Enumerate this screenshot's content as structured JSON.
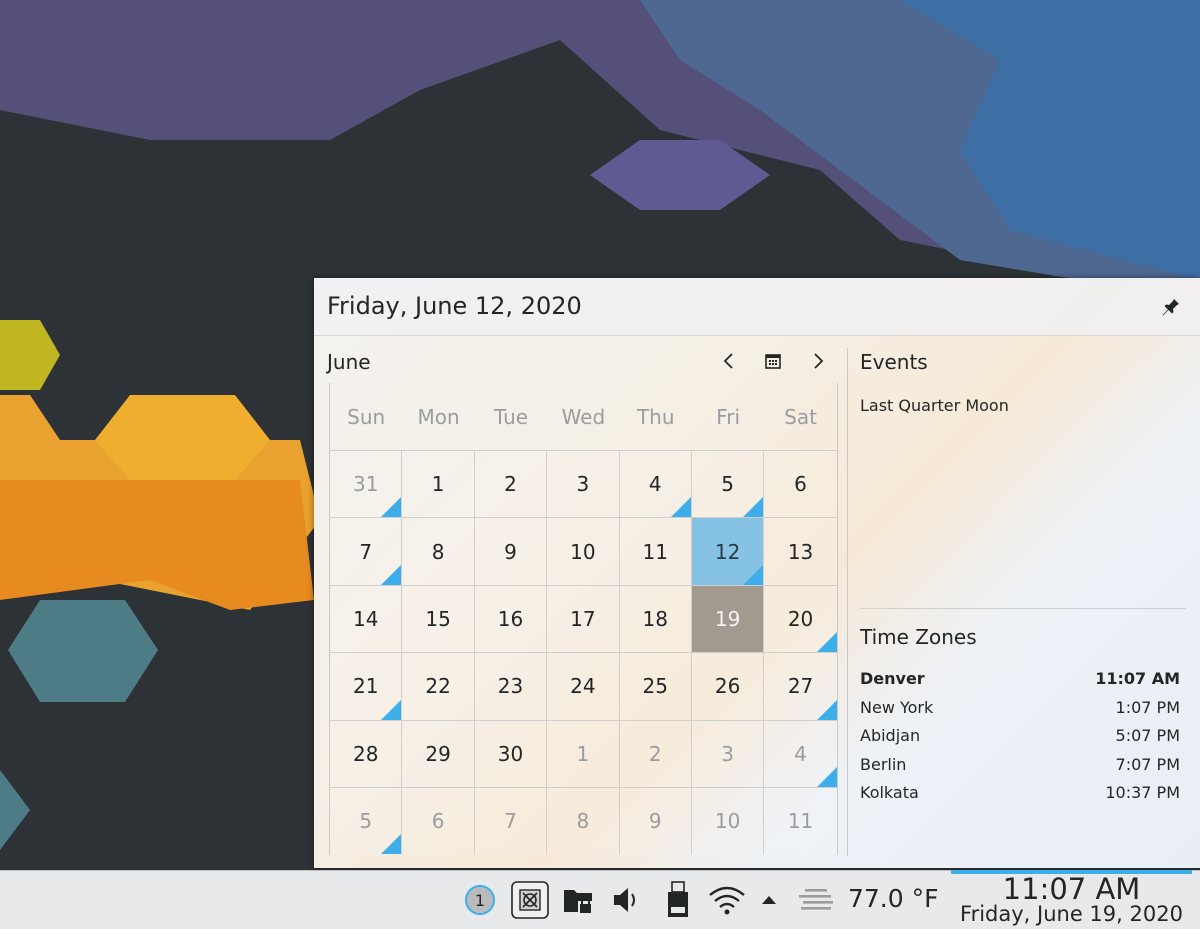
{
  "popup": {
    "title": "Friday, June 12, 2020",
    "pin_icon": "pin-icon"
  },
  "calendar": {
    "month_label": "June",
    "prev_icon": "chevron-left-icon",
    "today_icon": "calendar-icon",
    "next_icon": "chevron-right-icon",
    "weekdays": [
      "Sun",
      "Mon",
      "Tue",
      "Wed",
      "Thu",
      "Fri",
      "Sat"
    ],
    "weeks": [
      [
        {
          "d": "31",
          "o": true,
          "e": true
        },
        {
          "d": "1"
        },
        {
          "d": "2"
        },
        {
          "d": "3"
        },
        {
          "d": "4",
          "e": true
        },
        {
          "d": "5",
          "e": true
        },
        {
          "d": "6"
        }
      ],
      [
        {
          "d": "7",
          "e": true
        },
        {
          "d": "8"
        },
        {
          "d": "9"
        },
        {
          "d": "10"
        },
        {
          "d": "11"
        },
        {
          "d": "12",
          "sel": true,
          "e": true
        },
        {
          "d": "13"
        }
      ],
      [
        {
          "d": "14"
        },
        {
          "d": "15"
        },
        {
          "d": "16"
        },
        {
          "d": "17"
        },
        {
          "d": "18"
        },
        {
          "d": "19",
          "today": true
        },
        {
          "d": "20",
          "e": true
        }
      ],
      [
        {
          "d": "21",
          "e": true
        },
        {
          "d": "22"
        },
        {
          "d": "23"
        },
        {
          "d": "24"
        },
        {
          "d": "25"
        },
        {
          "d": "26"
        },
        {
          "d": "27",
          "e": true
        }
      ],
      [
        {
          "d": "28"
        },
        {
          "d": "29"
        },
        {
          "d": "30"
        },
        {
          "d": "1",
          "o": true
        },
        {
          "d": "2",
          "o": true
        },
        {
          "d": "3",
          "o": true
        },
        {
          "d": "4",
          "o": true,
          "e": true
        }
      ],
      [
        {
          "d": "5",
          "o": true,
          "e": true
        },
        {
          "d": "6",
          "o": true
        },
        {
          "d": "7",
          "o": true
        },
        {
          "d": "8",
          "o": true
        },
        {
          "d": "9",
          "o": true
        },
        {
          "d": "10",
          "o": true
        },
        {
          "d": "11",
          "o": true
        }
      ]
    ]
  },
  "events": {
    "title": "Events",
    "items": [
      "Last Quarter Moon"
    ]
  },
  "timezones": {
    "title": "Time Zones",
    "rows": [
      {
        "city": "Denver",
        "time": "11:07 AM",
        "bold": true
      },
      {
        "city": "New York",
        "time": "1:07 PM"
      },
      {
        "city": "Abidjan",
        "time": "5:07 PM"
      },
      {
        "city": "Berlin",
        "time": "7:07 PM"
      },
      {
        "city": "Kolkata",
        "time": "10:37 PM"
      }
    ]
  },
  "taskbar": {
    "notification_count": "1",
    "temperature": "77.0 °F",
    "clock_time": "11:07 AM",
    "clock_date": "Friday, June 19, 2020"
  },
  "colors": {
    "accent": "#3daee9",
    "selected_day": "#86c2e3",
    "today_day": "#a39a8f"
  }
}
